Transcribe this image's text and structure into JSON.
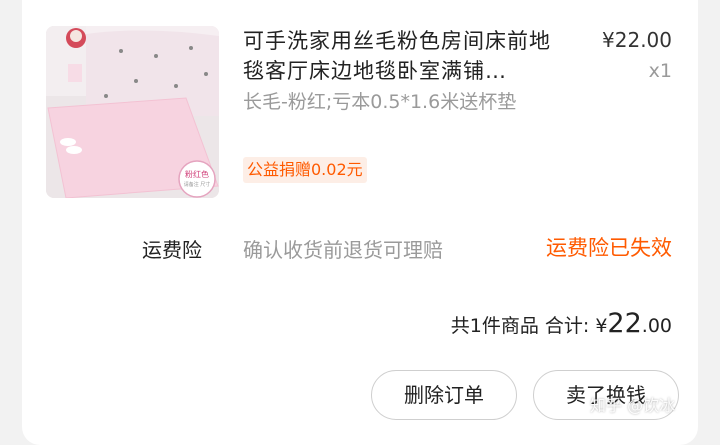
{
  "product": {
    "title": "可手洗家用丝毛粉色房间床前地毯客厅床边地毯卧室满铺…",
    "spec": "长毛-粉红;亏本0.5*1.6米送杯垫",
    "price": "¥22.00",
    "quantity": "x1",
    "charity": "公益捐赠0.02元",
    "image_tag": "粉红色",
    "image_tag_sub": "请备注 尺寸"
  },
  "insurance": {
    "label": "运费险",
    "description": "确认收货前退货可理赔",
    "status": "运费险已失效"
  },
  "summary": {
    "count_text": "共1件商品 合计:",
    "currency": "¥",
    "amount_int": "22",
    "amount_dec": ".00"
  },
  "actions": {
    "delete_label": "删除订单",
    "resell_label": "卖了换钱"
  },
  "watermark": "知乎 @饮冰",
  "colors": {
    "accent": "#ff5a00",
    "muted": "#9a9a9a",
    "text": "#222222"
  }
}
